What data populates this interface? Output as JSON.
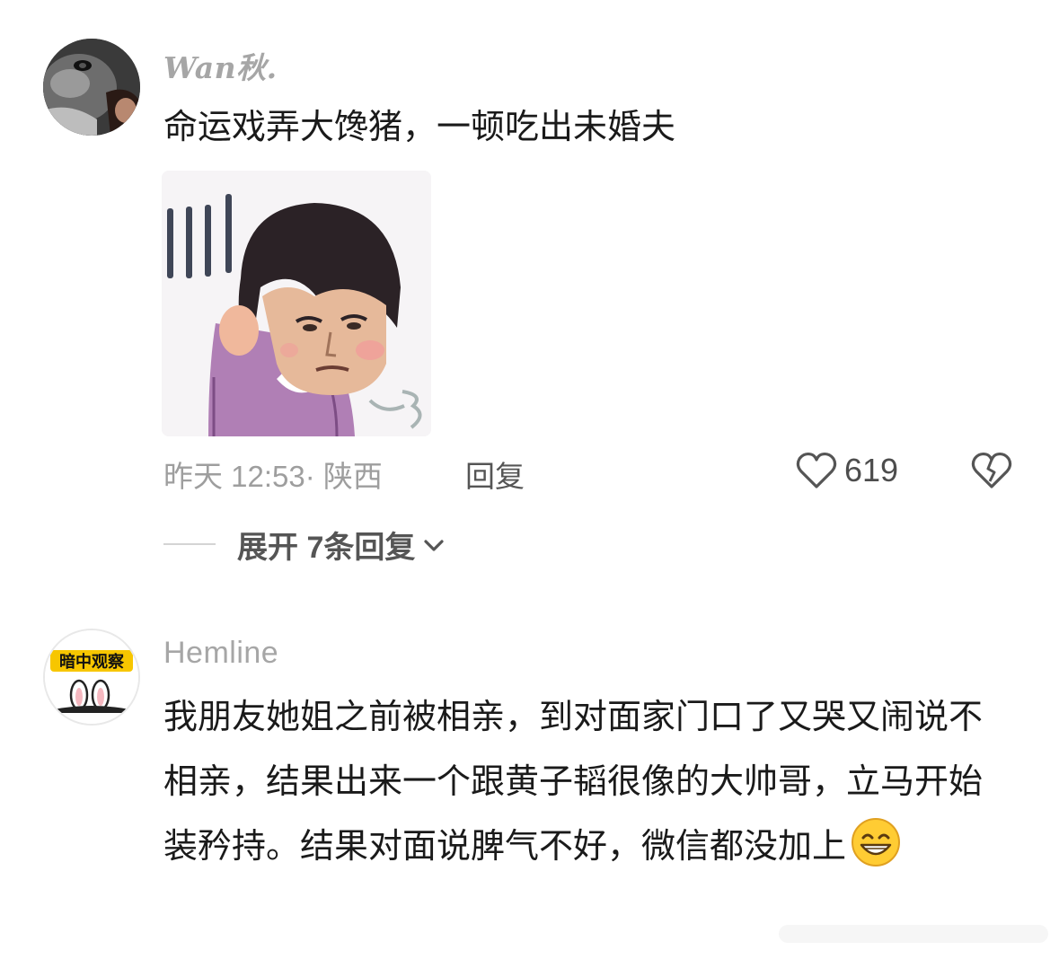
{
  "comments": [
    {
      "username": "Wan秋.",
      "text": "命运戏弄大馋猪，一顿吃出未婚夫",
      "meta": "昨天 12:53· 陕西",
      "reply_label": "回复",
      "likes": "619",
      "expand_label": "展开 7条回复"
    },
    {
      "username": "Hemline",
      "avatar_text": "暗中观察",
      "text": "我朋友她姐之前被相亲，到对面家门口了又哭又闹说不相亲，结果出来一个跟黄子韬很像的大帅哥，立马开始装矜持。结果对面说脾气不好，微信都没加上"
    }
  ],
  "colors": {
    "meta_gray": "#9e9e9e",
    "username_gray": "#a6a6a6",
    "text_dark": "#1a1a1a",
    "sticker_shirt": "#b07fb5",
    "sticker_hair": "#2b2226"
  },
  "icons": [
    "heart-outline-icon",
    "broken-heart-icon",
    "chevron-down-icon",
    "grinning-emoji-icon"
  ]
}
